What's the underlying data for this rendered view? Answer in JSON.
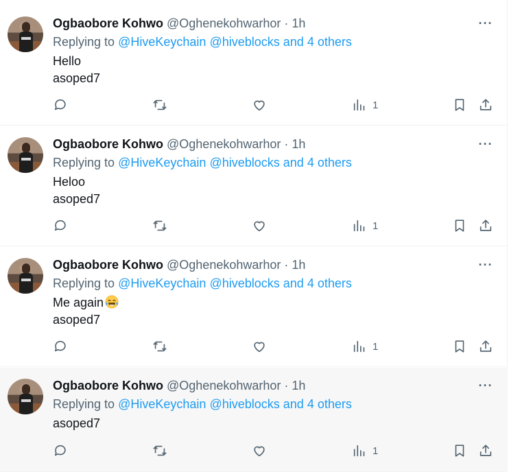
{
  "tweets": [
    {
      "name": "Ogbaobore Kohwo",
      "handle": "@Oghenekohwarhor",
      "dot": "·",
      "time": "1h",
      "replying_prefix": "Replying to",
      "mention1": "@HiveKeychain",
      "mention2": "@hiveblocks",
      "and_others": "and 4 others",
      "lines": [
        "Hello",
        "asoped7"
      ],
      "views": "1",
      "more": "···"
    },
    {
      "name": "Ogbaobore Kohwo",
      "handle": "@Oghenekohwarhor",
      "dot": "·",
      "time": "1h",
      "replying_prefix": "Replying to",
      "mention1": "@HiveKeychain",
      "mention2": "@hiveblocks",
      "and_others": "and 4 others",
      "lines": [
        "Heloo",
        "asoped7"
      ],
      "views": "1",
      "more": "···"
    },
    {
      "name": "Ogbaobore Kohwo",
      "handle": "@Oghenekohwarhor",
      "dot": "·",
      "time": "1h",
      "replying_prefix": "Replying to",
      "mention1": "@HiveKeychain",
      "mention2": "@hiveblocks",
      "and_others": "and 4 others",
      "lines": [
        "Me again",
        "asoped7"
      ],
      "emoji": "face-with-tears-of-joy",
      "views": "1",
      "more": "···"
    },
    {
      "name": "Ogbaobore Kohwo",
      "handle": "@Oghenekohwarhor",
      "dot": "·",
      "time": "1h",
      "replying_prefix": "Replying to",
      "mention1": "@HiveKeychain",
      "mention2": "@hiveblocks",
      "and_others": "and 4 others",
      "lines": [
        "asoped7"
      ],
      "views": "1",
      "more": "···"
    }
  ],
  "colors": {
    "link": "#1d9bf0",
    "muted": "#536471",
    "text": "#0f1419",
    "hover_bg": "#f7f7f7"
  },
  "icons": [
    "reply-icon",
    "retweet-icon",
    "like-icon",
    "views-icon",
    "bookmark-icon",
    "share-icon",
    "more-icon"
  ]
}
